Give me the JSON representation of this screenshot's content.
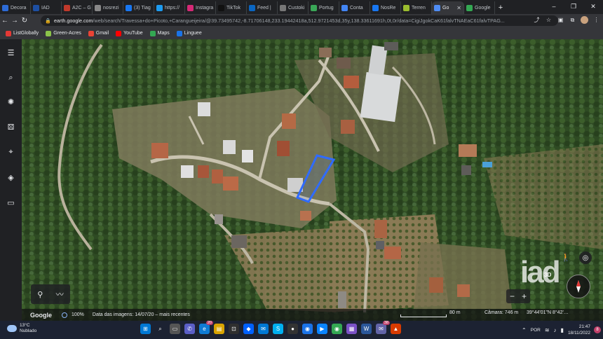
{
  "browser": {
    "tabs": [
      {
        "label": "Decora",
        "color": "#2d6bd6"
      },
      {
        "label": "IAD",
        "color": "#1d4fa3"
      },
      {
        "label": "A2C – G",
        "color": "#c0392b"
      },
      {
        "label": "nosrezi",
        "color": "#888888"
      },
      {
        "label": "(3) Tiag",
        "color": "#1877f2"
      },
      {
        "label": "https://",
        "color": "#1d9bf0"
      },
      {
        "label": "Instagra",
        "color": "#d62976"
      },
      {
        "label": "TikTok",
        "color": "#111111"
      },
      {
        "label": "Feed |",
        "color": "#0a66c2"
      },
      {
        "label": "Custoki",
        "color": "#777777"
      },
      {
        "label": "Portug",
        "color": "#3aa757"
      },
      {
        "label": "Conta",
        "color": "#4285f4"
      },
      {
        "label": "NosRe",
        "color": "#1877f2"
      },
      {
        "label": "Terren",
        "color": "#9bbd2f"
      },
      {
        "label": "Go",
        "color": "#4f8df5"
      },
      {
        "label": "Google",
        "color": "#34a853"
      }
    ],
    "url_host": "earth.google.com",
    "url_rest": "/web/search/Travessa+do+Picoto,+Carangueijeira/@39.73495742,-8.71706148,233.19442418a,512.9721453d,35y,138.33611691h,0t,0r/data=CigiJgokCaK61falvTNAEaC61falvTPAG...",
    "bookmarks": [
      {
        "label": "ListGlobally",
        "color": "#e53935"
      },
      {
        "label": "Green-Acres",
        "color": "#8bc34a"
      },
      {
        "label": "Gmail",
        "color": "#ea4335"
      },
      {
        "label": "YouTube",
        "color": "#ff0000"
      },
      {
        "label": "Maps",
        "color": "#34a853"
      },
      {
        "label": "Linguee",
        "color": "#1a73e8"
      }
    ]
  },
  "earth": {
    "brand": "Google",
    "progress_label": "100%",
    "imagery_date": "Data das imagens: 14/07/20 – mais recentes",
    "scale_label": "80 m",
    "camera": "Câmara: 746 m",
    "coords": "39°44'01\"N 8°42'…",
    "btn_3d": "3D",
    "zoom_minus": "−",
    "zoom_plus": "+",
    "parcel_color": "#2f6bff",
    "watermark": "iad"
  },
  "taskbar": {
    "weather_temp": "13°C",
    "weather_desc": "Nublado",
    "time": "21:47",
    "date": "18/11/2022",
    "lang": "POR",
    "notif_count": "8",
    "badge_edge": "20",
    "badge_chat": "38"
  }
}
